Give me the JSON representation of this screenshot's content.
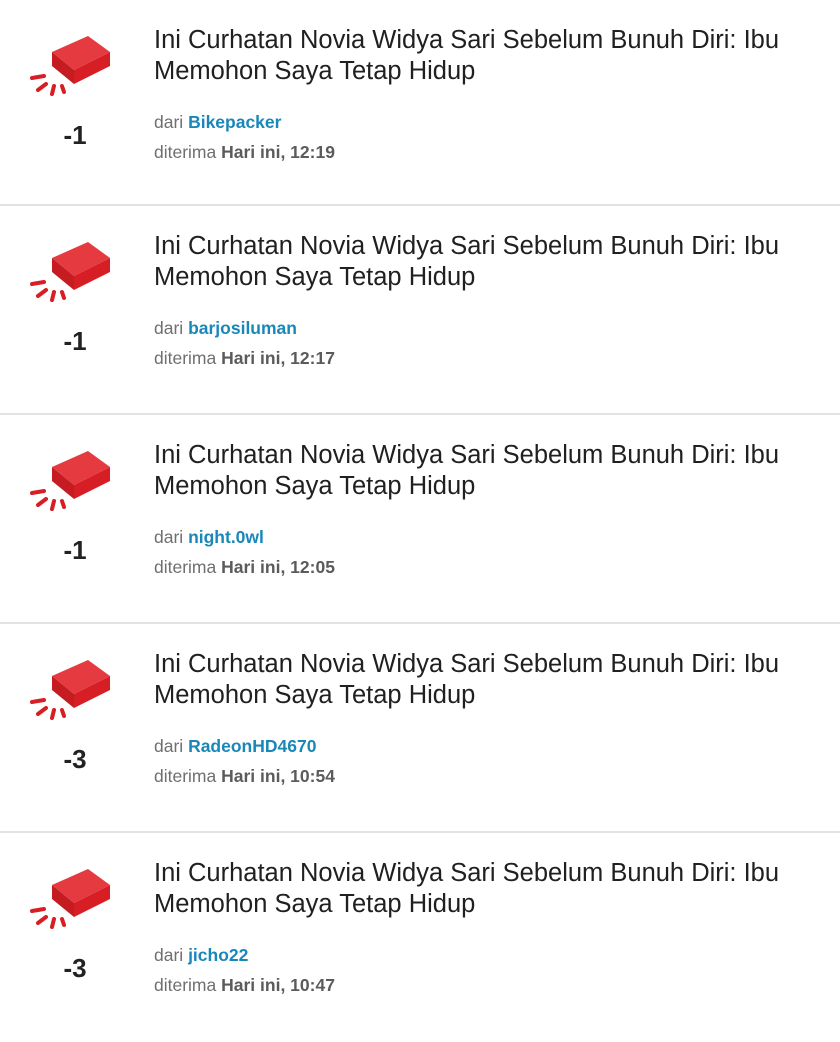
{
  "feed": {
    "items": [
      {
        "title": "Ini Curhatan Novia Widya Sari Sebelum Bunuh Diri: Ibu Memohon Saya Tetap Hidup",
        "score": "-1",
        "from_label": "dari",
        "user": "Bikepacker",
        "received_label": "diterima",
        "time": "Hari ini, 12:19"
      },
      {
        "title": "Ini Curhatan Novia Widya Sari Sebelum Bunuh Diri: Ibu Memohon Saya Tetap Hidup",
        "score": "-1",
        "from_label": "dari",
        "user": "barjosiluman",
        "received_label": "diterima",
        "time": "Hari ini, 12:17"
      },
      {
        "title": "Ini Curhatan Novia Widya Sari Sebelum Bunuh Diri: Ibu Memohon Saya Tetap Hidup",
        "score": "-1",
        "from_label": "dari",
        "user": "night.0wl",
        "received_label": "diterima",
        "time": "Hari ini, 12:05"
      },
      {
        "title": "Ini Curhatan Novia Widya Sari Sebelum Bunuh Diri: Ibu Memohon Saya Tetap Hidup",
        "score": "-3",
        "from_label": "dari",
        "user": "RadeonHD4670",
        "received_label": "diterima",
        "time": "Hari ini, 10:54"
      },
      {
        "title": "Ini Curhatan Novia Widya Sari Sebelum Bunuh Diri: Ibu Memohon Saya Tetap Hidup",
        "score": "-3",
        "from_label": "dari",
        "user": "jicho22",
        "received_label": "diterima",
        "time": "Hari ini, 10:47"
      }
    ]
  },
  "icons": {
    "item_icon": "brick-icon"
  },
  "colors": {
    "brick": "#d81e25",
    "brick_dark": "#a8141a",
    "username": "#1a87b9"
  }
}
